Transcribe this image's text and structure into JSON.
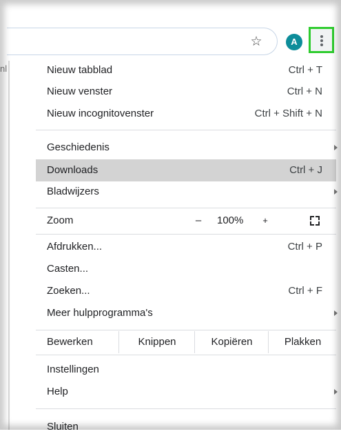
{
  "header": {
    "avatar_initial": "A",
    "side_text": "nl",
    "accent_color": "#2ecc2e"
  },
  "menu": {
    "group1": [
      {
        "label": "Nieuw tabblad",
        "shortcut": "Ctrl + T"
      },
      {
        "label": "Nieuw venster",
        "shortcut": "Ctrl + N"
      },
      {
        "label": "Nieuw incognitovenster",
        "shortcut": "Ctrl + Shift + N"
      }
    ],
    "group2": [
      {
        "label": "Geschiedenis",
        "shortcut": ""
      },
      {
        "label": "Downloads",
        "shortcut": "Ctrl + J"
      },
      {
        "label": "Bladwijzers",
        "shortcut": ""
      }
    ],
    "zoom": {
      "label": "Zoom",
      "minus": "–",
      "value": "100%",
      "plus": "+"
    },
    "group3": [
      {
        "label": "Afdrukken...",
        "shortcut": "Ctrl + P"
      },
      {
        "label": "Casten...",
        "shortcut": ""
      },
      {
        "label": "Zoeken...",
        "shortcut": "Ctrl + F"
      },
      {
        "label": "Meer hulpprogramma's",
        "shortcut": ""
      }
    ],
    "edit": {
      "label": "Bewerken",
      "cut": "Knippen",
      "copy": "Kopiëren",
      "paste": "Plakken"
    },
    "group4": [
      {
        "label": "Instellingen"
      },
      {
        "label": "Help"
      }
    ],
    "exit": {
      "label": "Sluiten"
    }
  }
}
